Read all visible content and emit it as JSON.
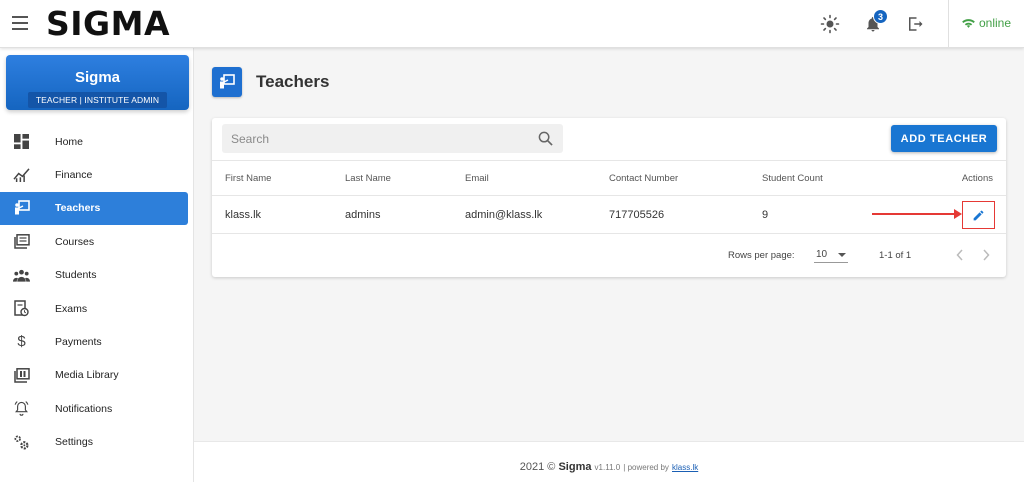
{
  "topbar": {
    "logo": "SIGMA",
    "notification_count": "3",
    "status_label": "online",
    "status_color": "#43a047",
    "icons": [
      "menu-icon",
      "brightness-icon",
      "bell-icon",
      "logout-icon",
      "wifi-icon"
    ]
  },
  "sidebar": {
    "brand_title": "Sigma",
    "brand_role": "TEACHER | INSTITUTE ADMIN",
    "items": [
      {
        "label": "Home",
        "icon": "dashboard-icon"
      },
      {
        "label": "Finance",
        "icon": "chart-icon"
      },
      {
        "label": "Teachers",
        "icon": "teacher-icon",
        "active": true
      },
      {
        "label": "Courses",
        "icon": "courses-icon"
      },
      {
        "label": "Students",
        "icon": "students-icon"
      },
      {
        "label": "Exams",
        "icon": "exams-icon"
      },
      {
        "label": "Payments",
        "icon": "dollar-icon"
      },
      {
        "label": "Media Library",
        "icon": "media-library-icon"
      },
      {
        "label": "Notifications",
        "icon": "notifications-icon"
      },
      {
        "label": "Settings",
        "icon": "settings-icon"
      }
    ],
    "accent_color": "#2d7fda"
  },
  "main": {
    "page_title": "Teachers",
    "search_placeholder": "Search",
    "add_button_label": "ADD TEACHER",
    "table": {
      "columns": [
        "First Name",
        "Last Name",
        "Email",
        "Contact Number",
        "Student Count",
        "Actions"
      ],
      "rows": [
        {
          "first_name": "klass.lk",
          "last_name": "admins",
          "email": "admin@klass.lk",
          "contact": "717705526",
          "student_count": "9"
        }
      ]
    },
    "pagination": {
      "rows_per_page_label": "Rows per page:",
      "rows_per_page_value": "10",
      "range_text": "1-1 of 1"
    }
  },
  "footer": {
    "prefix": "2021 ©",
    "brand": "Sigma",
    "version": "v1.11.0",
    "powered_by": "| powered by",
    "link_text": "klass.lk"
  }
}
